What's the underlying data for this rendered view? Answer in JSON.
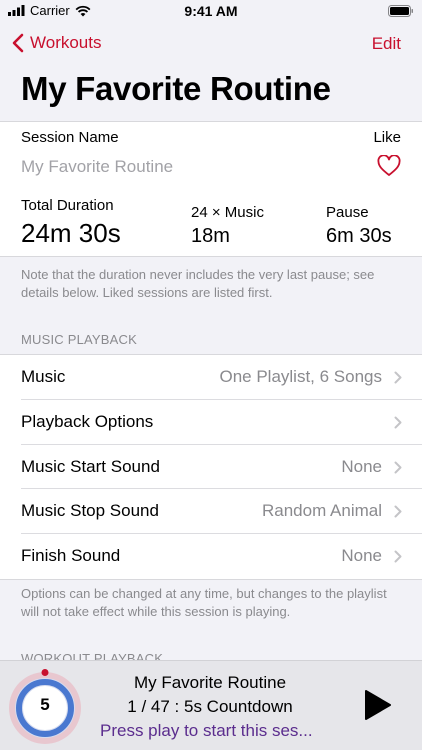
{
  "status_bar": {
    "carrier": "Carrier",
    "time": "9:41 AM"
  },
  "nav": {
    "back_label": "Workouts",
    "edit_label": "Edit"
  },
  "page_title": "My Favorite Routine",
  "session": {
    "name_label": "Session Name",
    "name_placeholder": "My Favorite Routine",
    "like_label": "Like",
    "total_duration_label": "Total Duration",
    "total_duration_value": "24m 30s",
    "music_label": "24 × Music",
    "music_value": "18m",
    "pause_label": "Pause",
    "pause_value": "6m 30s"
  },
  "duration_note": "Note that the duration never includes the very last pause; see details below. Liked sessions are listed first.",
  "music_playback": {
    "header": "MUSIC PLAYBACK",
    "rows": [
      {
        "label": "Music",
        "value": "One Playlist, 6 Songs"
      },
      {
        "label": "Playback Options",
        "value": ""
      },
      {
        "label": "Music Start Sound",
        "value": "None"
      },
      {
        "label": "Music Stop Sound",
        "value": "Random Animal"
      },
      {
        "label": "Finish Sound",
        "value": "None"
      }
    ],
    "footer": "Options can be changed at any time, but changes to the playlist will not take effect while this session is playing."
  },
  "workout_playback_header": "WORKOUT PLAYBACK",
  "player": {
    "countdown_number": "5",
    "title": "My Favorite Routine",
    "subtitle": "1 / 47 : 5s Countdown",
    "hint": "Press play to start this ses..."
  },
  "colors": {
    "accent": "#c8102e",
    "hint": "#5b2d8e",
    "ring": "#4a78d0"
  }
}
